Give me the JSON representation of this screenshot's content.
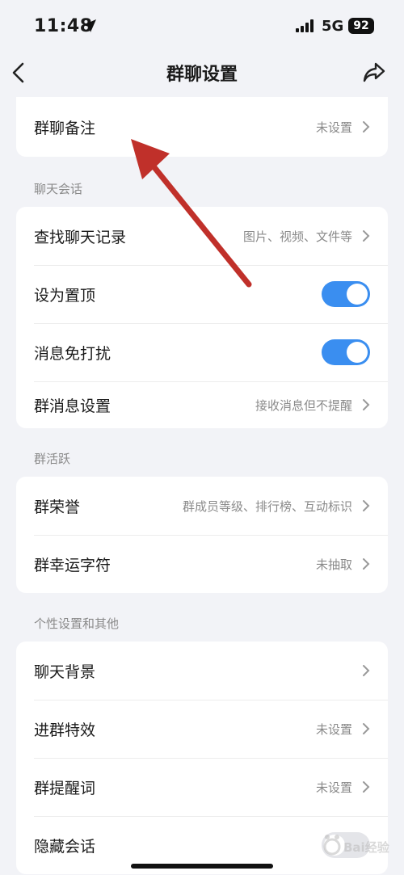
{
  "status": {
    "time": "11:48",
    "network": "5G",
    "battery": "92"
  },
  "nav": {
    "title": "群聊设置"
  },
  "group_remark": {
    "label": "群聊备注",
    "value": "未设置"
  },
  "chat_session": {
    "title": "聊天会话",
    "search_history": {
      "label": "查找聊天记录",
      "value": "图片、视频、文件等"
    },
    "pin_top": {
      "label": "设为置顶",
      "on": true
    },
    "do_not_disturb": {
      "label": "消息免打扰",
      "on": true
    },
    "group_message_settings": {
      "label": "群消息设置",
      "value": "接收消息但不提醒"
    }
  },
  "group_activity": {
    "title": "群活跃",
    "honor": {
      "label": "群荣誉",
      "value": "群成员等级、排行榜、互动标识"
    },
    "lucky_char": {
      "label": "群幸运字符",
      "value": "未抽取"
    }
  },
  "personal": {
    "title": "个性设置和其他",
    "chat_background": {
      "label": "聊天背景"
    },
    "join_effect": {
      "label": "进群特效",
      "value": "未设置"
    },
    "reminder_words": {
      "label": "群提醒词",
      "value": "未设置"
    },
    "hide_chat": {
      "label": "隐藏会话",
      "on": false
    }
  },
  "watermark": {
    "text": "Bai经验"
  },
  "colors": {
    "accent": "#3a8ef0",
    "annotation_arrow": "#c0302a",
    "background": "#f2f3f7"
  }
}
